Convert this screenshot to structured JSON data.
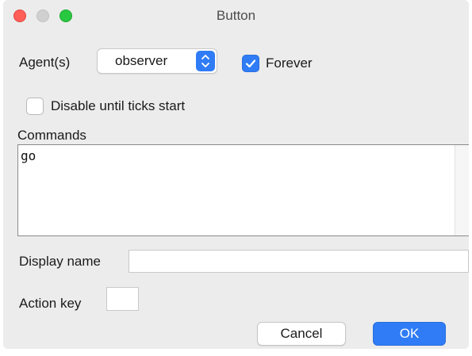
{
  "window": {
    "title": "Button"
  },
  "agents": {
    "label": "Agent(s)",
    "selected": "observer"
  },
  "forever": {
    "label": "Forever",
    "checked": true
  },
  "disable_until_ticks": {
    "label": "Disable until ticks start",
    "checked": false
  },
  "commands": {
    "label": "Commands",
    "value": "go"
  },
  "display_name": {
    "label": "Display name",
    "value": ""
  },
  "action_key": {
    "label": "Action key",
    "value": ""
  },
  "buttons": {
    "cancel": "Cancel",
    "ok": "OK"
  },
  "colors": {
    "accent": "#2f7cf6",
    "close": "#ff5f57",
    "maximize": "#28c840",
    "window_bg": "#ececec"
  }
}
